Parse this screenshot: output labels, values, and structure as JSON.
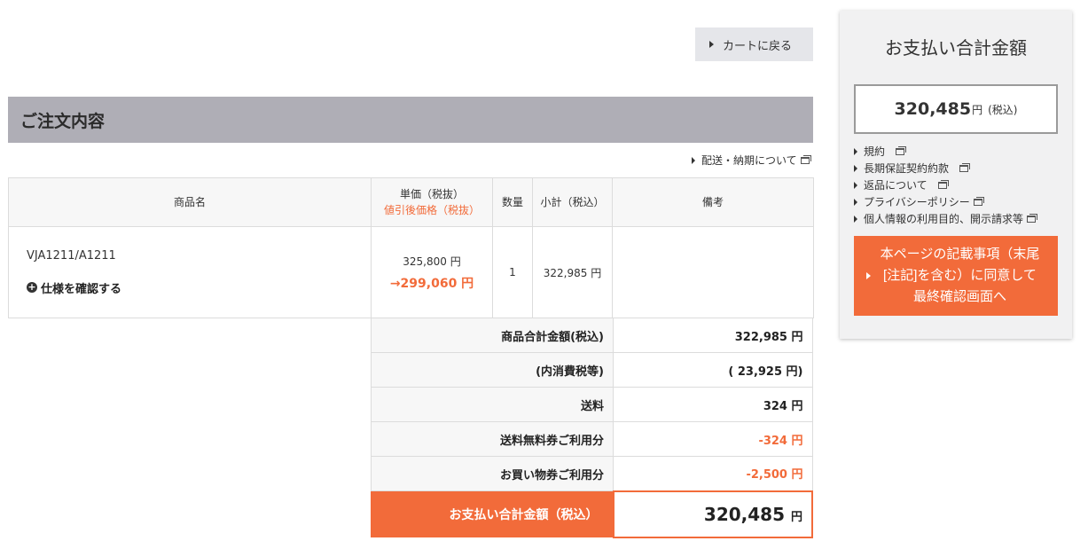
{
  "back_to_cart": "カートに戻る",
  "section_title": "ご注文内容",
  "delivery_link": "配送・納期について",
  "table": {
    "headers": {
      "product": "商品名",
      "unit_price": "単価（税抜）",
      "unit_price_sub": "値引後価格（税抜）",
      "qty": "数量",
      "subtotal": "小計（税込）",
      "notes": "備考"
    },
    "row": {
      "product_name": "VJA1211/A1211",
      "spec_link": "仕様を確認する",
      "price_original": "325,800 円",
      "price_discounted": "→299,060 円",
      "qty": "1",
      "subtotal": "322,985 円",
      "notes": ""
    }
  },
  "totals": [
    {
      "label": "商品合計金額(税込)",
      "value": "322,985 円",
      "negative": false
    },
    {
      "label": "(内消費税等)",
      "value": "( 23,925 円)",
      "negative": false
    },
    {
      "label": "送料",
      "value": "324 円",
      "negative": false
    },
    {
      "label": "送料無料券ご利用分",
      "value": "-324 円",
      "negative": true
    },
    {
      "label": "お買い物券ご利用分",
      "value": "-2,500 円",
      "negative": true
    }
  ],
  "grand_total": {
    "label": "お支払い合計金額（税込）",
    "amount": "320,485",
    "unit": "円"
  },
  "summary": {
    "title": "お支払い合計金額",
    "amount": "320,485",
    "unit": "円",
    "tax_note": "(税込)",
    "links": [
      "規約",
      "長期保証契約約款",
      "返品について",
      "プライバシーポリシー",
      "個人情報の利用目的、開示請求等"
    ],
    "cta": "本ページの記載事項（末尾[注記]を含む）に同意して最終確認画面へ"
  },
  "colors": {
    "accent": "#f26b3a",
    "header_bg": "#afaeb6",
    "panel_bg": "#f1f1f2"
  },
  "icons": [
    "caret-right-icon",
    "new-window-icon",
    "plus-circle-icon"
  ]
}
